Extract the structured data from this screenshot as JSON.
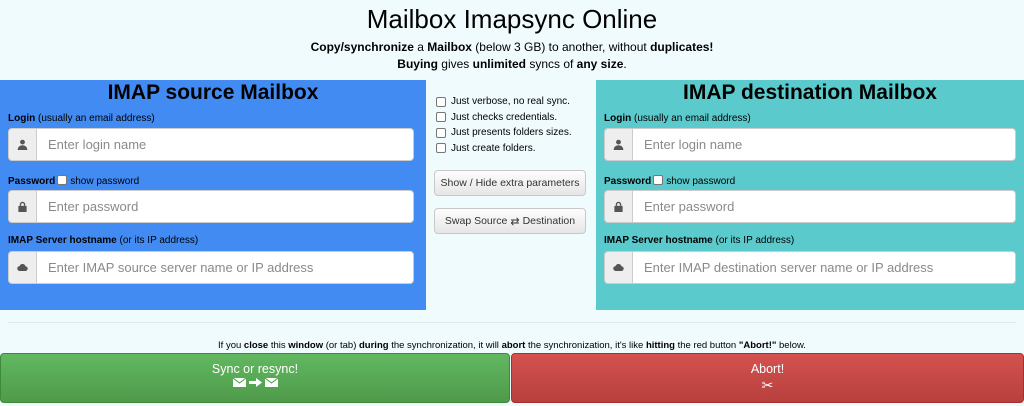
{
  "header": {
    "title": "Mailbox Imapsync Online",
    "line1": {
      "p1": "Copy/synchronize",
      "p2": " a ",
      "p3": "Mailbox",
      "p4": " (below 3 GB) to another, without ",
      "p5": "duplicates!"
    },
    "line2": {
      "p1": "Buying",
      "p2": " gives ",
      "p3": "unlimited",
      "p4": " syncs of ",
      "p5": "any size",
      "p6": "."
    }
  },
  "source": {
    "heading": "IMAP source Mailbox",
    "login_label": "Login",
    "login_hint": " (usually an email address)",
    "login_placeholder": "Enter login name",
    "password_label": "Password",
    "show_password_label": "show password",
    "password_placeholder": "Enter password",
    "host_label": "IMAP Server hostname",
    "host_hint": " (or its IP address)",
    "host_placeholder": "Enter IMAP source server name or IP address"
  },
  "destination": {
    "heading": "IMAP destination Mailbox",
    "login_label": "Login",
    "login_hint": " (usually an email address)",
    "login_placeholder": "Enter login name",
    "password_label": "Password",
    "show_password_label": "show password",
    "password_placeholder": "Enter password",
    "host_label": "IMAP Server hostname",
    "host_hint": " (or its IP address)",
    "host_placeholder": "Enter IMAP destination server name or IP address"
  },
  "options": [
    {
      "label": "Just verbose, no real sync."
    },
    {
      "label": "Just checks credentials."
    },
    {
      "label": "Just presents folders sizes."
    },
    {
      "label": "Just create folders."
    }
  ],
  "buttons": {
    "extra": "Show / Hide extra parameters",
    "swap_left": "Swap Source",
    "swap_right": "Destination",
    "sync": "Sync or resync!",
    "abort": "Abort!"
  },
  "warning": {
    "w1": "If you ",
    "w2": "close",
    "w3": " this ",
    "w4": "window",
    "w5": " (or tab) ",
    "w6": "during",
    "w7": " the synchronization, it will ",
    "w8": "abort",
    "w9": " the synchronization, it's like ",
    "w10": "hitting",
    "w11": " the red button ",
    "w12": "\"Abort!\"",
    "w13": " below."
  },
  "icons": {
    "login": "user-icon",
    "password": "lock-icon",
    "host": "cloud-icon",
    "swap": "swap-arrows-icon",
    "sync": "envelope-arrow-envelope-icon",
    "abort": "scissors-icon"
  },
  "colors": {
    "source_panel": "#428bf3",
    "destination_panel": "#5bcacd",
    "sync_button": "#5aab57",
    "abort_button": "#c84a47",
    "page_background": "#f0fbfd"
  }
}
